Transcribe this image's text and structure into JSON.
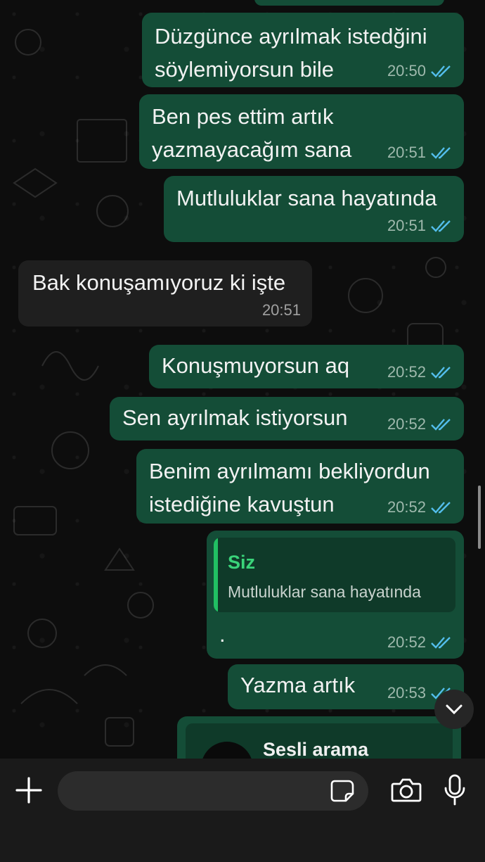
{
  "messages": [
    {
      "id": "m1",
      "dir": "out",
      "text": "Düzgünce ayrılmak istedğini\nsöylemiyorsun bile",
      "time": "20:50",
      "status": "read"
    },
    {
      "id": "m2",
      "dir": "out",
      "text": "Ben pes ettim artık\nyazmayacağım sana",
      "time": "20:51",
      "status": "read"
    },
    {
      "id": "m3",
      "dir": "out",
      "text": "Mutluluklar sana hayatında",
      "time": "20:51",
      "status": "read"
    },
    {
      "id": "m4",
      "dir": "in",
      "text": "Bak konuşamıyoruz ki işte",
      "time": "20:51"
    },
    {
      "id": "m5",
      "dir": "out",
      "text": "Konuşmuyorsun aq",
      "time": "20:52",
      "status": "read"
    },
    {
      "id": "m6",
      "dir": "out",
      "text": "Sen ayrılmak istiyorsun",
      "time": "20:52",
      "status": "read"
    },
    {
      "id": "m7",
      "dir": "out",
      "text": "Benim ayrılmamı bekliyordun\nistediğine kavuştun",
      "time": "20:52",
      "status": "read"
    },
    {
      "id": "m8",
      "dir": "out",
      "text": ".",
      "time": "20:52",
      "status": "read",
      "quote": {
        "author": "Siz",
        "text": "Mutluluklar sana hayatında"
      }
    },
    {
      "id": "m9",
      "dir": "out",
      "text": "Yazma artık",
      "time": "20:53",
      "status": "read"
    }
  ],
  "call_card": {
    "title": "Sesli arama"
  },
  "composer": {
    "placeholder": ""
  },
  "colors": {
    "outgoing": "#144d37",
    "incoming": "#1f1f1f",
    "read_ticks": "#53bdeb",
    "quote_bar": "#21c063"
  },
  "icons": {
    "plus": "plus-icon",
    "sticker": "sticker-icon",
    "camera": "camera-icon",
    "mic": "mic-icon",
    "scroll": "chevron-down-icon",
    "call": "voice-call-icon",
    "ticks": "double-check-icon"
  }
}
